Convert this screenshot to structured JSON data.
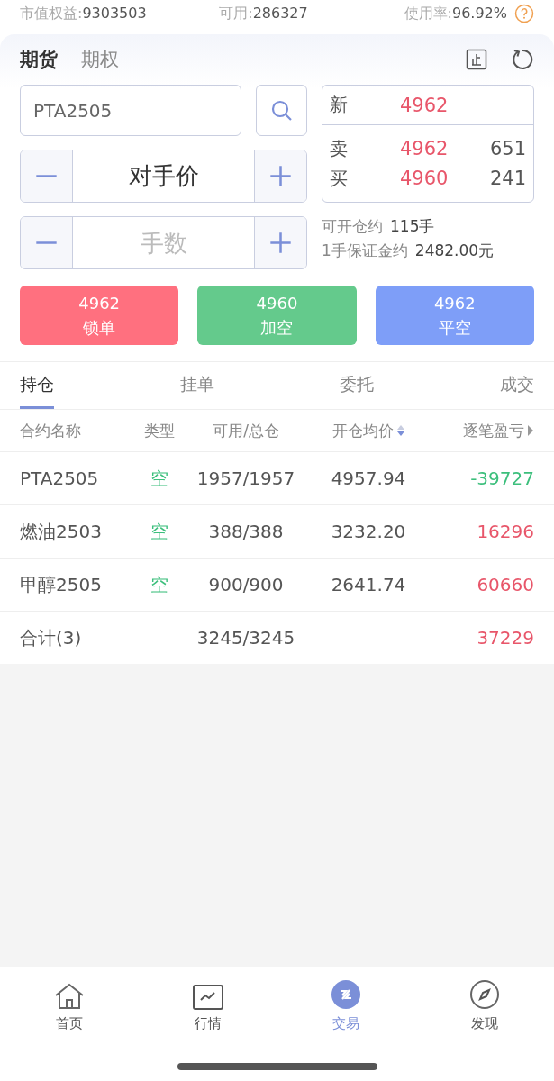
{
  "summary": [
    {
      "label": "市值权益:",
      "value": "9303503"
    },
    {
      "label": "可用:",
      "value": "286327"
    },
    {
      "label": "使用率:",
      "value": "96.92%"
    }
  ],
  "product_tabs": [
    {
      "label": "期货",
      "selected": true
    },
    {
      "label": "期权",
      "selected": false
    }
  ],
  "contract_field": {
    "value": "PTA2505"
  },
  "price_stepper": {
    "value": "对手价"
  },
  "quantity_stepper": {
    "placeholder": "手数"
  },
  "quote": {
    "last": {
      "label": "新",
      "price": "4962"
    },
    "levels": [
      {
        "label": "卖",
        "price": "4962",
        "volume": "651"
      },
      {
        "label": "买",
        "price": "4960",
        "volume": "241"
      }
    ]
  },
  "info": [
    {
      "label": "可开仓约",
      "value": "115手"
    },
    {
      "label": "1手保证金约",
      "value": "2482.00元"
    }
  ],
  "actions": [
    {
      "price": "4962",
      "label": "锁单",
      "kind": "lock"
    },
    {
      "price": "4960",
      "label": "加空",
      "kind": "add"
    },
    {
      "price": "4962",
      "label": "平空",
      "kind": "close"
    }
  ],
  "list_tabs": [
    {
      "label": "持仓",
      "selected": true
    },
    {
      "label": "挂单",
      "selected": false
    },
    {
      "label": "委托",
      "selected": false
    },
    {
      "label": "成交",
      "selected": false
    }
  ],
  "table": {
    "columns": [
      {
        "label": "合约名称",
        "kind": "plain"
      },
      {
        "label": "类型",
        "kind": "plain"
      },
      {
        "label": "可用/总仓",
        "kind": "plain"
      },
      {
        "label": "开仓均价",
        "kind": "sort"
      },
      {
        "label": "逐笔盈亏",
        "kind": "more"
      }
    ],
    "rows": [
      {
        "contract": "PTA2505",
        "type": "空",
        "available": "1957/1957",
        "avg_price": "4957.94",
        "pnl": "-39727",
        "color": "#3cbf7c"
      },
      {
        "contract": "燃油2503",
        "type": "空",
        "available": "388/388",
        "avg_price": "3232.20",
        "pnl": "16296",
        "color": "#e8566a"
      },
      {
        "contract": "甲醇2505",
        "type": "空",
        "available": "900/900",
        "avg_price": "2641.74",
        "pnl": "60660",
        "color": "#e8566a"
      }
    ],
    "total": {
      "label": "合计(3)",
      "available": "3245/3245",
      "pnl": "37229",
      "color": "#e8566a"
    }
  },
  "nav": [
    {
      "label": "首页",
      "kind": "home",
      "selected": false
    },
    {
      "label": "行情",
      "kind": "chart",
      "selected": false
    },
    {
      "label": "交易",
      "kind": "trade",
      "selected": true
    },
    {
      "label": "发现",
      "kind": "compass",
      "selected": false
    }
  ]
}
